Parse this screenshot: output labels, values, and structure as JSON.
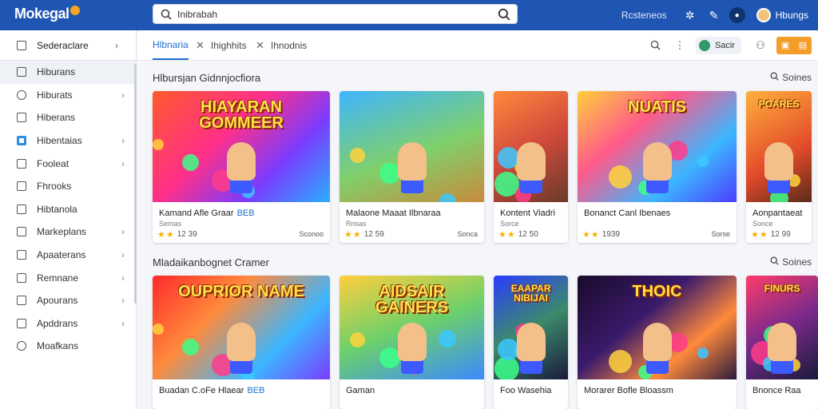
{
  "app": {
    "logo": "Mokegal",
    "search_value": "Inibrabah",
    "top_links": [
      "Rcsteneos"
    ],
    "user_name": "Hbungs"
  },
  "sidebar": {
    "header": "Sederaclare",
    "items": [
      {
        "label": "Hiburans",
        "icon": "checkbox-icon",
        "chevron": false,
        "active": true
      },
      {
        "label": "Hiburats",
        "icon": "compass-icon",
        "chevron": true,
        "active": false
      },
      {
        "label": "Hiberans",
        "icon": "calendar-icon",
        "chevron": false,
        "active": false
      },
      {
        "label": "Hibentaias",
        "icon": "tv-icon",
        "chevron": true,
        "active": false
      },
      {
        "label": "Fooleat",
        "icon": "grid-icon",
        "chevron": true,
        "active": false
      },
      {
        "label": "Fhrooks",
        "icon": "checkbox-icon",
        "chevron": false,
        "active": false
      },
      {
        "label": "Hibtanola",
        "icon": "document-icon",
        "chevron": false,
        "active": false
      },
      {
        "label": "Markeplans",
        "icon": "checkbox-icon",
        "chevron": true,
        "active": false
      },
      {
        "label": "Apaaterans",
        "icon": "edit-icon",
        "chevron": true,
        "active": false
      },
      {
        "label": "Remnane",
        "icon": "checkbox-icon",
        "chevron": true,
        "active": false
      },
      {
        "label": "Apourans",
        "icon": "grid-icon",
        "chevron": true,
        "active": false
      },
      {
        "label": "Apddrans",
        "icon": "grid-icon",
        "chevron": true,
        "active": false
      },
      {
        "label": "Moafkans",
        "icon": "compass-icon",
        "chevron": false,
        "active": false
      }
    ]
  },
  "tabs": [
    {
      "label": "Hlbnaria",
      "active": true
    },
    {
      "label": "Ihighhits",
      "active": false
    },
    {
      "label": "Ihnodnis",
      "active": false
    }
  ],
  "toolbar": {
    "pill_label": "Sacir"
  },
  "sections": [
    {
      "title": "Hlbursjan Gidnnjocfiora",
      "more": "Soines",
      "cards": [
        {
          "thumb_text": "HIAYARAN GOMMEER",
          "title": "Kamand Afle Graar",
          "tag": "BEB",
          "sub": "Semas",
          "rating": "12 39",
          "price": "Sconoo"
        },
        {
          "thumb_text": "",
          "title": "Malaone Maaat Ilbnaraa",
          "tag": "",
          "sub": "Rnsas",
          "rating": "12 59",
          "price": "Sonca"
        },
        {
          "thumb_text": "",
          "title": "Kontent Viadri",
          "tag": "",
          "sub": "Sorce",
          "rating": "12 50",
          "price": ""
        },
        {
          "thumb_text": "NUATIS",
          "title": "Bonanct Canl Ibenaes",
          "tag": "",
          "sub": "",
          "rating": "1939",
          "price": "Sorse"
        },
        {
          "thumb_text": "POARES",
          "title": "Aonpantaeat",
          "tag": "",
          "sub": "Sonce",
          "rating": "12 99",
          "price": ""
        }
      ]
    },
    {
      "title": "Mladaikanbognet Cramer",
      "more": "Soines",
      "cards": [
        {
          "thumb_text": "OUPRIOR NAME",
          "title": "Buadan C.oFe Hlaear",
          "tag": "BEB",
          "sub": "",
          "rating": "",
          "price": ""
        },
        {
          "thumb_text": "AIDSAIR GAINERS",
          "title": "Gaman",
          "tag": "",
          "sub": "",
          "rating": "",
          "price": ""
        },
        {
          "thumb_text": "EAAPAR NIBIJAI",
          "title": "Foo Wasehia",
          "tag": "",
          "sub": "",
          "rating": "",
          "price": ""
        },
        {
          "thumb_text": "THOIC",
          "title": "Morarer Bofle Bloassm",
          "tag": "",
          "sub": "",
          "rating": "",
          "price": ""
        },
        {
          "thumb_text": "FINURS",
          "title": "Bnonce Raa",
          "tag": "",
          "sub": "",
          "rating": "",
          "price": ""
        }
      ]
    }
  ],
  "colors": {
    "topbar": "#1f55b3",
    "accent": "#1f6fd0",
    "star": "#f5b301",
    "orange": "#f59d2a",
    "tag": "#1f6fd0"
  }
}
